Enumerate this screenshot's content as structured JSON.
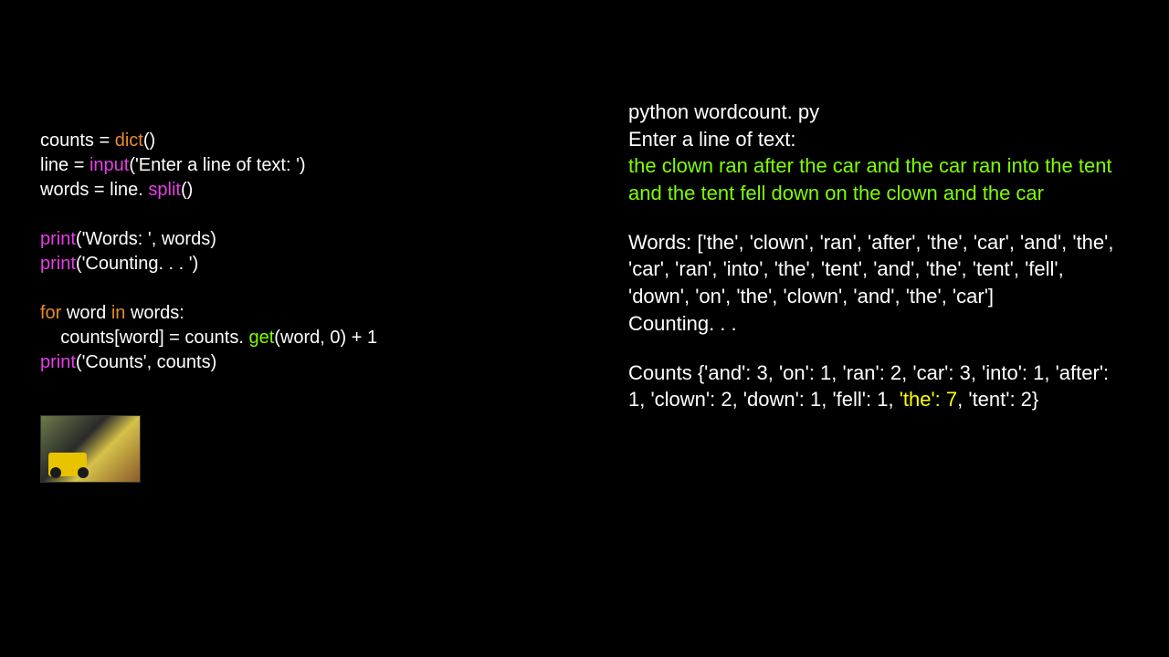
{
  "code": {
    "l1a": "counts = ",
    "l1b": "dict",
    "l1c": "()",
    "l2a": "line = ",
    "l2b": "input",
    "l2c": "('Enter a line of text: ')",
    "l3a": "words = line. ",
    "l3b": "split",
    "l3c": "()",
    "l4a": "print",
    "l4b": "('Words: ', words)",
    "l5a": "print",
    "l5b": "('Counting. . . ')",
    "l6a": "for",
    "l6b": " word ",
    "l6c": "in",
    "l6d": " words:",
    "l7a": "    counts[word] = counts. ",
    "l7b": "get",
    "l7c": "(word, 0) + 1",
    "l8a": "print",
    "l8b": "('Counts', counts)"
  },
  "out": {
    "cmd": "python wordcount. py",
    "prompt": "Enter a line of text:",
    "input": "the clown ran after the car and the car ran into the tent and the tent fell down on the clown and the car",
    "words": "Words: ['the', 'clown', 'ran', 'after', 'the', 'car', 'and', 'the', 'car', 'ran', 'into', 'the', 'tent', 'and', 'the', 'tent', 'fell', 'down', 'on', 'the', 'clown', 'and', 'the', 'car']",
    "counting": "Counting. . .",
    "counts_a": "Counts {'and': 3, 'on': 1, 'ran': 2, 'car': 3, 'into': 1, 'after': 1, 'clown': 2, 'down': 1, 'fell': 1, ",
    "counts_hl": "'the': 7",
    "counts_b": ", 'tent': 2}"
  }
}
